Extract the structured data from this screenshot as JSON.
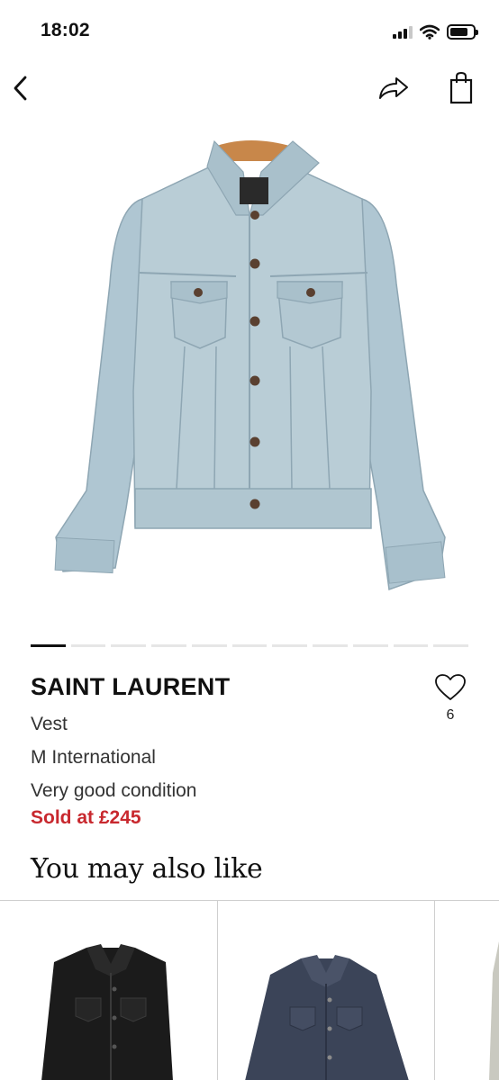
{
  "status_bar": {
    "time": "18:02"
  },
  "product": {
    "brand": "SAINT LAURENT",
    "type": "Vest",
    "size": "M International",
    "condition": "Very good condition",
    "sold_label": "Sold at £245",
    "favorites_count": "6",
    "image_count": 11,
    "active_image_index": 0
  },
  "recommendations": {
    "title": "You may also like"
  },
  "colors": {
    "sold_red": "#c8282e",
    "denim_light": "#b9cdd6",
    "indicator_active": "#111111"
  },
  "icons": {
    "back": "chevron-left-icon",
    "share": "share-arrow-icon",
    "bag": "shopping-bag-icon",
    "favorite": "heart-outline-icon"
  }
}
